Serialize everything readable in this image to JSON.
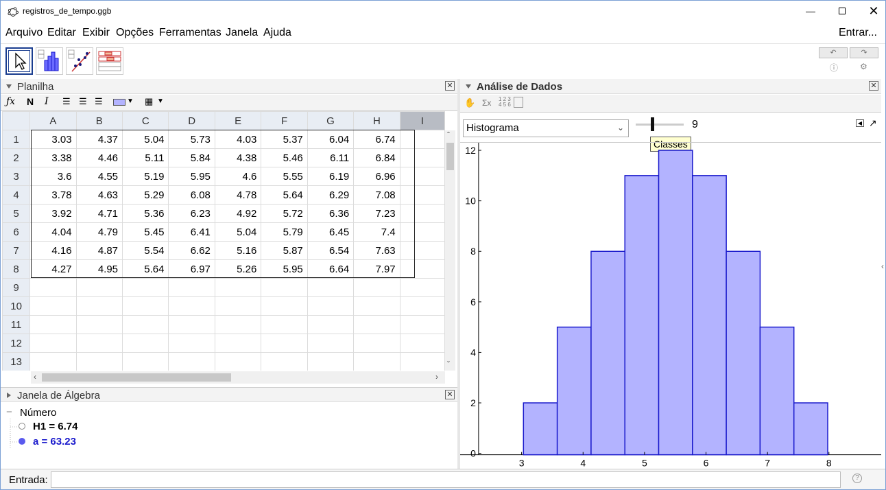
{
  "window": {
    "title": "registros_de_tempo.ggb"
  },
  "menu": [
    "Arquivo",
    "Editar",
    "Exibir",
    "Opções",
    "Ferramentas",
    "Janela",
    "Ajuda"
  ],
  "signin": "Entrar...",
  "spreadsheet": {
    "title": "Planilha",
    "columns": [
      "A",
      "B",
      "C",
      "D",
      "E",
      "F",
      "G",
      "H",
      "I"
    ],
    "rows": [
      [
        "3.03",
        "4.37",
        "5.04",
        "5.73",
        "4.03",
        "5.37",
        "6.04",
        "6.74"
      ],
      [
        "3.38",
        "4.46",
        "5.11",
        "5.84",
        "4.38",
        "5.46",
        "6.11",
        "6.84"
      ],
      [
        "3.6",
        "4.55",
        "5.19",
        "5.95",
        "4.6",
        "5.55",
        "6.19",
        "6.96"
      ],
      [
        "3.78",
        "4.63",
        "5.29",
        "6.08",
        "4.78",
        "5.64",
        "6.29",
        "7.08"
      ],
      [
        "3.92",
        "4.71",
        "5.36",
        "6.23",
        "4.92",
        "5.72",
        "6.36",
        "7.23"
      ],
      [
        "4.04",
        "4.79",
        "5.45",
        "6.41",
        "5.04",
        "5.79",
        "6.45",
        "7.4"
      ],
      [
        "4.16",
        "4.87",
        "5.54",
        "6.62",
        "5.16",
        "5.87",
        "6.54",
        "7.63"
      ],
      [
        "4.27",
        "4.95",
        "5.64",
        "6.97",
        "5.26",
        "5.95",
        "6.64",
        "7.97"
      ]
    ],
    "row_numbers": [
      "1",
      "2",
      "3",
      "4",
      "5",
      "6",
      "7",
      "8",
      "9",
      "10",
      "11",
      "12",
      "13"
    ]
  },
  "algebra": {
    "title": "Janela de Álgebra",
    "group": "Número",
    "items": [
      {
        "text": "H1 = 6.74",
        "color": "#000000"
      },
      {
        "text": "a = 63.23",
        "color": "#1a1acc"
      }
    ]
  },
  "analysis": {
    "title": "Análise de Dados",
    "chart_type_label": "Histograma",
    "classes_value": "9",
    "classes_tooltip": "Classes"
  },
  "entry_label": "Entrada:",
  "chart_data": {
    "type": "bar",
    "bins": [
      {
        "from": 3.03,
        "to": 3.58,
        "value": 2
      },
      {
        "from": 3.58,
        "to": 4.13,
        "value": 5
      },
      {
        "from": 4.13,
        "to": 4.68,
        "value": 8
      },
      {
        "from": 4.68,
        "to": 5.23,
        "value": 11
      },
      {
        "from": 5.23,
        "to": 5.78,
        "value": 12
      },
      {
        "from": 5.78,
        "to": 6.33,
        "value": 11
      },
      {
        "from": 6.33,
        "to": 6.88,
        "value": 8
      },
      {
        "from": 6.88,
        "to": 7.43,
        "value": 5
      },
      {
        "from": 7.43,
        "to": 7.98,
        "value": 2
      }
    ],
    "x_ticks": [
      3,
      4,
      5,
      6,
      7,
      8
    ],
    "y_ticks": [
      0,
      2,
      4,
      6,
      8,
      10,
      12
    ],
    "xlim": [
      2.0,
      8.85
    ],
    "ylim": [
      -0.2,
      12.3
    ],
    "bar_color": "#b3b3ff",
    "bar_stroke": "#1a1acc"
  }
}
